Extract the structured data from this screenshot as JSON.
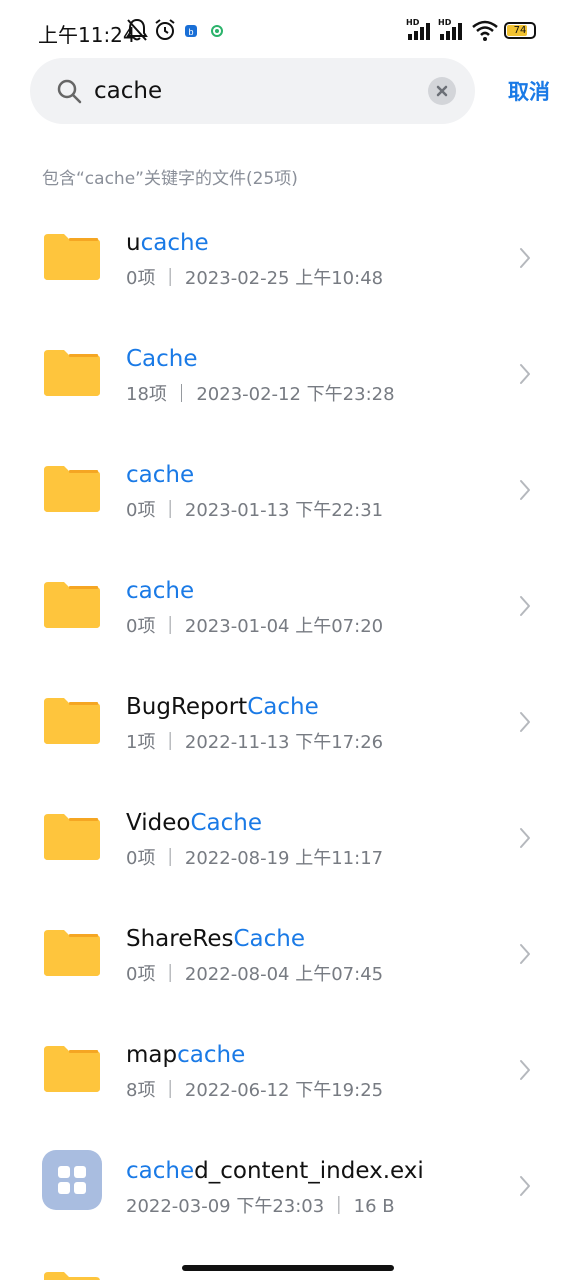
{
  "status_bar": {
    "time": "上午11:24",
    "battery": "74",
    "network_1": "HD",
    "network_2": "HD"
  },
  "search": {
    "query": "cache",
    "cancel_label": "取消"
  },
  "result_header": "包含“cache”关键字的文件(25项)",
  "items": [
    {
      "prefix": "u",
      "match": "cache",
      "suffix": "",
      "meta": "0项 ｜ 2023-02-25 上午10:48",
      "type": "folder"
    },
    {
      "prefix": "",
      "match": "Cache",
      "suffix": "",
      "meta": "18项 ｜ 2023-02-12 下午23:28",
      "type": "folder"
    },
    {
      "prefix": "",
      "match": "cache",
      "suffix": "",
      "meta": "0项 ｜ 2023-01-13 下午22:31",
      "type": "folder"
    },
    {
      "prefix": "",
      "match": "cache",
      "suffix": "",
      "meta": "0项 ｜ 2023-01-04 上午07:20",
      "type": "folder"
    },
    {
      "prefix": "BugReport",
      "match": "Cache",
      "suffix": "",
      "meta": "1项 ｜ 2022-11-13 下午17:26",
      "type": "folder"
    },
    {
      "prefix": "Video",
      "match": "Cache",
      "suffix": "",
      "meta": "0项 ｜ 2022-08-19 上午11:17",
      "type": "folder"
    },
    {
      "prefix": "ShareRes",
      "match": "Cache",
      "suffix": "",
      "meta": "0项 ｜ 2022-08-04 上午07:45",
      "type": "folder"
    },
    {
      "prefix": "map",
      "match": "cache",
      "suffix": "",
      "meta": "8项 ｜ 2022-06-12 下午19:25",
      "type": "folder"
    },
    {
      "prefix": "",
      "match": "cache",
      "suffix": "d_content_index.exi",
      "meta": "2022-03-09 下午23:03 ｜ 16 B",
      "type": "file"
    }
  ],
  "colors": {
    "accent": "#1a7ae6",
    "folder": "#fec53d",
    "folder_tab": "#f5a623",
    "file_icon_bg": "#a9bde0"
  }
}
